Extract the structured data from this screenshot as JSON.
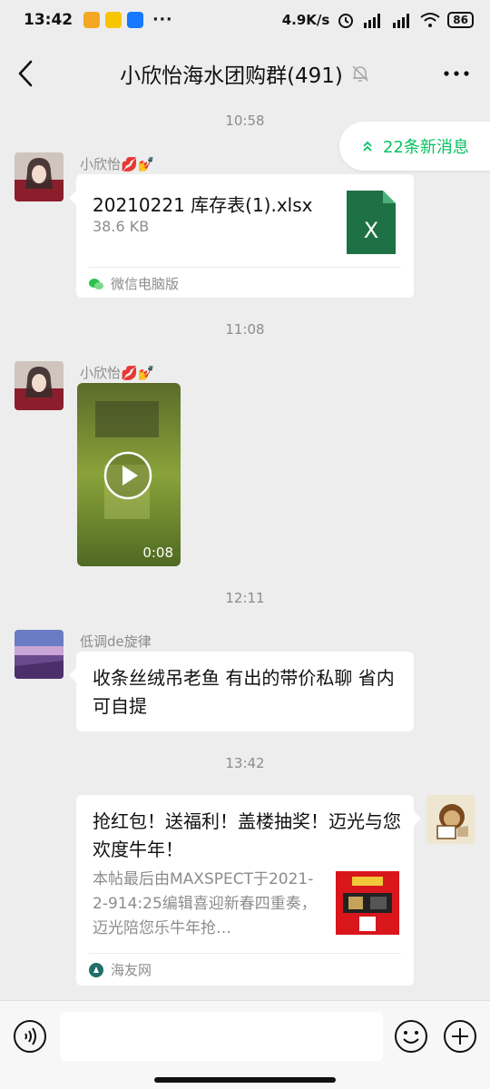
{
  "status_bar": {
    "time": "13:42",
    "dots": "···",
    "network_speed": "4.9K/s",
    "battery": "86"
  },
  "nav": {
    "title": "小欣怡海水团购群(491)"
  },
  "new_messages": {
    "label": "22条新消息",
    "color": "#07c160"
  },
  "messages": [
    {
      "timestamp": "10:58"
    },
    {
      "sender": "小欣怡💋💅",
      "type": "file",
      "file_name": "20210221 库存表(1).xlsx",
      "file_size": "38.6 KB",
      "file_icon_letter": "X",
      "source": "微信电脑版"
    },
    {
      "timestamp": "11:08"
    },
    {
      "sender": "小欣怡💋💅",
      "type": "video",
      "duration": "0:08"
    },
    {
      "timestamp": "12:11"
    },
    {
      "sender": "低调de旋律",
      "type": "text",
      "text": "收条丝绒吊老鱼  有出的带价私聊 省内可自提"
    },
    {
      "timestamp": "13:42"
    },
    {
      "type": "link",
      "outgoing": true,
      "title": "抢红包！送福利！盖楼抽奖！迈光与您欢度牛年！",
      "description": "本帖最后由MAXSPECT于2021-2-914:25编辑喜迎新春四重奏，迈光陪您乐牛年抢…",
      "source": "海友网"
    }
  ]
}
